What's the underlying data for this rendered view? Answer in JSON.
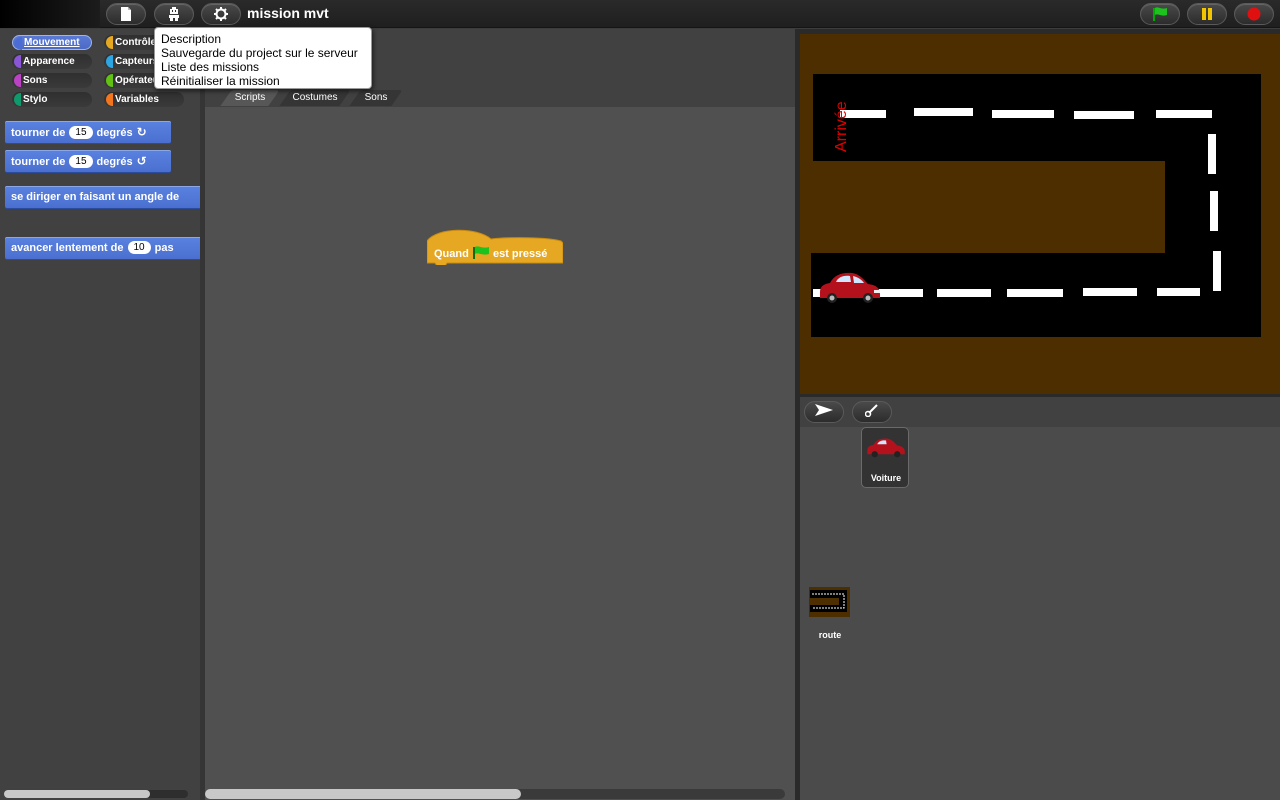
{
  "app": {
    "project_title": "mission mvt"
  },
  "toolbar": {
    "buttons": [
      {
        "name": "file",
        "icon": "file-icon"
      },
      {
        "name": "cloud",
        "icon": "robot-icon"
      },
      {
        "name": "settings",
        "icon": "gear-icon"
      }
    ],
    "green_flag_icon": "green-flag-icon",
    "pause_icon": "pause-icon",
    "stop_icon": "stop-icon"
  },
  "project_menu": {
    "items": [
      "Description",
      "Sauvegarde du project sur le serveur",
      "Liste des missions",
      "Réinitialiser la mission"
    ]
  },
  "categories": {
    "items": [
      {
        "label": "Mouvement",
        "color": "#4a6cd4",
        "selected": true
      },
      {
        "label": "Contrôle",
        "color": "#e6a822",
        "selected": false
      },
      {
        "label": "Apparence",
        "color": "#8a55d7",
        "selected": false
      },
      {
        "label": "Capteurs",
        "color": "#2ca5e2",
        "selected": false
      },
      {
        "label": "Sons",
        "color": "#bb42c3",
        "selected": false
      },
      {
        "label": "Opérateurs",
        "color": "#62c213",
        "selected": false
      },
      {
        "label": "Stylo",
        "color": "#0e9a6c",
        "selected": false
      },
      {
        "label": "Variables",
        "color": "#f3761d",
        "selected": false
      }
    ]
  },
  "blocks": {
    "turn_right": {
      "prefix": "tourner de",
      "value": "15",
      "suffix": "degrés",
      "icon": "rotate-clockwise-icon"
    },
    "turn_left": {
      "prefix": "tourner de",
      "value": "15",
      "suffix": "degrés",
      "icon": "rotate-counterclockwise-icon"
    },
    "point_direction": {
      "label": "se diriger en faisant un angle de"
    },
    "move_slowly": {
      "prefix": "avancer lentement de",
      "value": "10",
      "suffix": "pas"
    }
  },
  "script_tabs": {
    "items": [
      {
        "label": "Scripts",
        "active": true
      },
      {
        "label": "Costumes",
        "active": false
      },
      {
        "label": "Sons",
        "active": false
      }
    ]
  },
  "scripts": {
    "hat_block": {
      "prefix": "Quand",
      "suffix": "est pressé",
      "color": "#e6a822",
      "icon": "green-flag-icon"
    }
  },
  "stage": {
    "finish_label": "Arrivée",
    "background_color": "#4d2e00",
    "road_color": "#000000",
    "finish_color": "#e00000"
  },
  "corral": {
    "sprites": [
      {
        "name": "Voiture",
        "icon": "car-icon"
      }
    ],
    "stage_label": "route"
  }
}
